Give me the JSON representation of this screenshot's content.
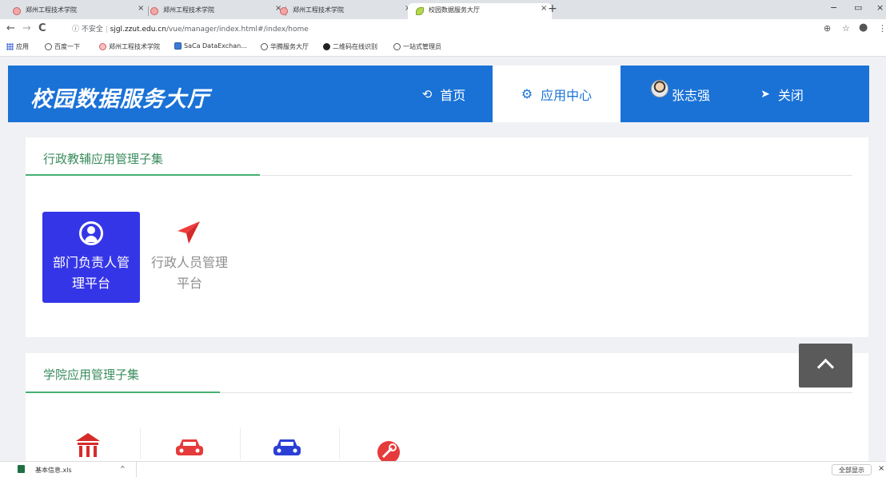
{
  "browser": {
    "tabs": [
      {
        "title": "郑州工程技术学院"
      },
      {
        "title": "郑州工程技术学院"
      },
      {
        "title": "郑州工程技术学院"
      },
      {
        "title": "校园数据服务大厅"
      }
    ],
    "new_tab": "+",
    "close": "×",
    "window_controls": [
      "−",
      "▭",
      "×"
    ],
    "nav": {
      "back": "←",
      "forward": "→",
      "reload": "C"
    },
    "url": {
      "security": "ⓘ 不安全",
      "host": "sjgl.zzut.edu.cn",
      "path": "/vue/manager/index.html#/index/home"
    },
    "addr_icons": [
      "⊕",
      "☆",
      "●",
      "⋮"
    ],
    "bookmarks": [
      {
        "label": "应用",
        "icon": "apps-grid-icon"
      },
      {
        "label": "百度一下",
        "icon": "globe-icon"
      },
      {
        "label": "郑州工程技术学院",
        "icon": "school-icon"
      },
      {
        "label": "SaCa DataExchan...",
        "icon": "saca-icon"
      },
      {
        "label": "华腾服务大厅",
        "icon": "globe-icon"
      },
      {
        "label": "二维码在线识别",
        "icon": "qr-icon"
      },
      {
        "label": "一站式管理员",
        "icon": "globe-icon"
      }
    ]
  },
  "header": {
    "logo": "校园数据服务大厅",
    "nav": [
      {
        "label": "首页",
        "icon": "home-icon"
      },
      {
        "label": "应用中心",
        "icon": "gear-icon"
      },
      {
        "label": "张志强",
        "icon": "avatar"
      },
      {
        "label": "关闭",
        "icon": "sign-out-icon"
      }
    ],
    "accent": "#1a72d6"
  },
  "sections": [
    {
      "title": "行政教辅应用管理子集",
      "apps": [
        {
          "label": "部门负责人管理平台",
          "line1": "部门负责人管",
          "line2": "理平台",
          "icon": "user-circle-icon",
          "selected": true
        },
        {
          "label": "行政人员管理平台",
          "line1": "行政人员管理",
          "line2": "平台",
          "icon": "paper-plane-icon",
          "selected": false
        }
      ]
    },
    {
      "title": "学院应用管理子集",
      "apps": [
        {
          "icon": "bank-icon"
        },
        {
          "icon": "car-icon"
        },
        {
          "icon": "car-icon"
        },
        {
          "icon": "tools-icon"
        }
      ]
    }
  ],
  "download": {
    "file": "基本信息.xls",
    "show_all": "全部显示",
    "close": "×",
    "chevron": "^"
  }
}
